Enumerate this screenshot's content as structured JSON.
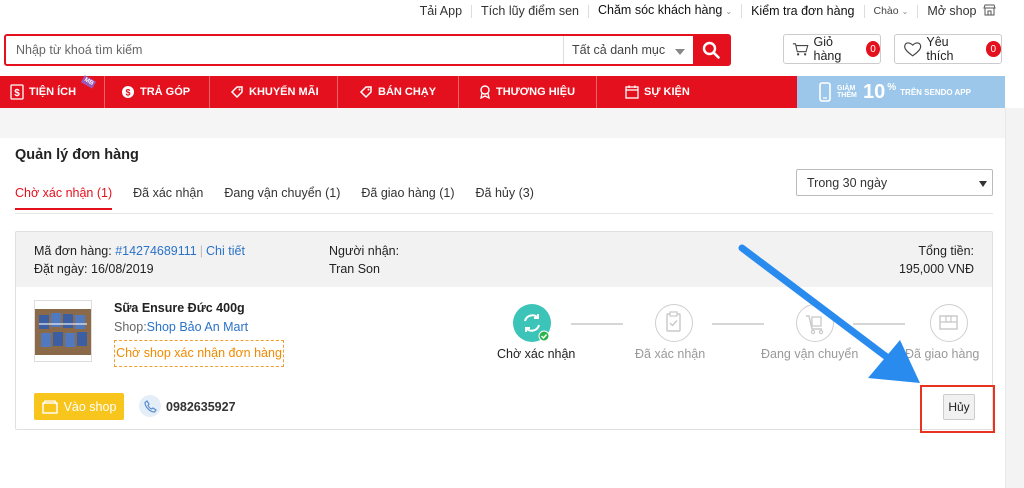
{
  "topbar": {
    "app": "Tải App",
    "points": "Tích lũy điểm sen",
    "support": "Chăm sóc khách hàng",
    "track": "Kiểm tra đơn hàng",
    "greeting": "Chào",
    "open_shop": "Mở shop"
  },
  "search": {
    "placeholder": "Nhập từ khoá tìm kiếm",
    "category": "Tất cả danh mục"
  },
  "header": {
    "cart_label": "Giỏ hàng",
    "cart_count": "0",
    "wishlist_label": "Yêu thích",
    "wishlist_count": "0"
  },
  "nav": {
    "items": [
      "TIỆN ÍCH",
      "TRẢ GÓP",
      "KHUYẾN MÃI",
      "BÁN CHẠY",
      "THƯƠNG HIỆU",
      "SỰ KIỆN"
    ],
    "mb_badge": "MB",
    "promo": {
      "small": "GIẢM THÊM",
      "big": "10",
      "pct": "%",
      "text": "TRÊN SENDO APP"
    }
  },
  "page": {
    "title": "Quản lý đơn hàng",
    "tabs": [
      "Chờ xác nhận (1)",
      "Đã xác nhận",
      "Đang vận chuyển (1)",
      "Đã giao hàng (1)",
      "Đã hủy (3)"
    ],
    "period": "Trong 30 ngày"
  },
  "order": {
    "code_label": "Mã đơn hàng:",
    "code": "#14274689111",
    "detail": "Chi tiết",
    "date_label": "Đặt ngày:",
    "date": "16/08/2019",
    "recipient_label": "Người nhận:",
    "recipient": "Tran Son",
    "total_label": "Tổng tiền:",
    "total": "195,000 VNĐ",
    "product_name": "Sữa Ensure Đức 400g",
    "shop_label": "Shop:",
    "shop_name": "Shop Bảo An Mart",
    "waiting": "Chờ shop xác nhận đơn hàng",
    "steps": [
      "Chờ xác nhận",
      "Đã xác nhận",
      "Đang vận chuyển",
      "Đã giao hàng"
    ],
    "visit_shop": "Vào shop",
    "phone": "0982635927",
    "cancel": "Hủy"
  },
  "colors": {
    "brand": "#e5101d",
    "accent": "#2b72c9",
    "step_active": "#3cc4b8",
    "shop_button": "#f8c51d",
    "highlight": "#e8341f",
    "arrow": "#2a8bef"
  }
}
